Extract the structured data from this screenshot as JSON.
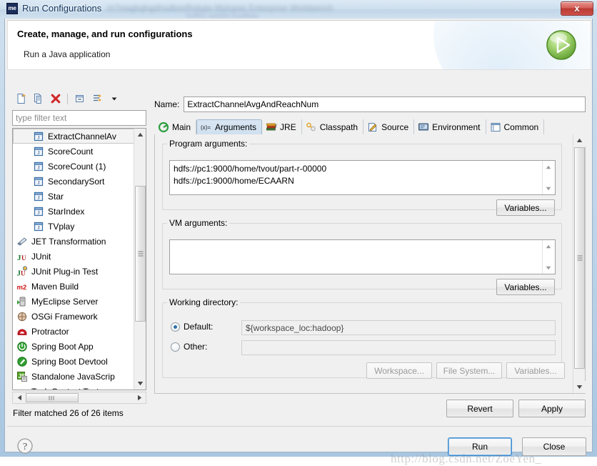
{
  "window": {
    "title": "Run Configurations",
    "app_icon_text": "me",
    "close_label": "x",
    "ghost_text_1": "  m7ewgbqhgdhsdbxefhstyjw   Mylcpse Enterprise Workbench",
    "ghost_text_2": "    Sdfhx wkfghj ksdfjwe"
  },
  "banner": {
    "title": "Create, manage, and run configurations",
    "subtitle": "Run a Java application",
    "run_icon": "run-play-icon"
  },
  "tree_toolbar": {
    "buttons": [
      {
        "name": "new-configuration-icon",
        "tooltip": "New launch configuration"
      },
      {
        "name": "duplicate-configuration-icon",
        "tooltip": "Duplicate"
      },
      {
        "name": "delete-configuration-icon",
        "tooltip": "Delete"
      },
      {
        "name": "collapse-all-icon",
        "tooltip": "Collapse All"
      },
      {
        "name": "filter-configuration-icon",
        "tooltip": "Filter"
      },
      {
        "name": "view-menu-chevron-icon",
        "tooltip": "View Menu"
      }
    ]
  },
  "filter": {
    "placeholder": "type filter text",
    "value": "",
    "status": "Filter matched 26 of 26 items"
  },
  "tree": {
    "items": [
      {
        "label": "ExtractChannelAv",
        "icon": "java-launch-icon",
        "indent": "child",
        "selected": true
      },
      {
        "label": "ScoreCount",
        "icon": "java-launch-icon",
        "indent": "child",
        "selected": false
      },
      {
        "label": "ScoreCount (1)",
        "icon": "java-launch-icon",
        "indent": "child",
        "selected": false
      },
      {
        "label": "SecondarySort",
        "icon": "java-launch-icon",
        "indent": "child",
        "selected": false
      },
      {
        "label": "Star",
        "icon": "java-launch-icon",
        "indent": "child",
        "selected": false
      },
      {
        "label": "StarIndex",
        "icon": "java-launch-icon",
        "indent": "child",
        "selected": false
      },
      {
        "label": "TVplay",
        "icon": "java-launch-icon",
        "indent": "child",
        "selected": false
      },
      {
        "label": "JET Transformation",
        "icon": "jet-transformation-icon",
        "indent": "root",
        "selected": false
      },
      {
        "label": "JUnit",
        "icon": "junit-icon",
        "indent": "root",
        "selected": false
      },
      {
        "label": "JUnit Plug-in Test",
        "icon": "junit-plugin-icon",
        "indent": "root",
        "selected": false
      },
      {
        "label": "Maven Build",
        "icon": "maven-icon",
        "indent": "root",
        "selected": false
      },
      {
        "label": "MyEclipse Server",
        "icon": "myeclipse-server-icon",
        "indent": "root",
        "selected": false
      },
      {
        "label": "OSGi Framework",
        "icon": "osgi-icon",
        "indent": "root",
        "selected": false
      },
      {
        "label": "Protractor",
        "icon": "protractor-icon",
        "indent": "root",
        "selected": false
      },
      {
        "label": "Spring Boot App",
        "icon": "spring-boot-icon",
        "indent": "root",
        "selected": false
      },
      {
        "label": "Spring Boot Devtool",
        "icon": "spring-devtools-icon",
        "indent": "root",
        "selected": false
      },
      {
        "label": "Standalone JavaScrip",
        "icon": "javascript-icon",
        "indent": "root",
        "selected": false
      },
      {
        "label": "Task Context Test",
        "icon": "task-context-icon",
        "indent": "root",
        "selected": false
      }
    ]
  },
  "config": {
    "name_label": "Name:",
    "name_value": "ExtractChannelAvgAndReachNum"
  },
  "tabs": [
    {
      "label": "Main",
      "icon": "main-tab-icon",
      "active": false
    },
    {
      "label": "Arguments",
      "icon": "arguments-tab-icon",
      "active": true
    },
    {
      "label": "JRE",
      "icon": "jre-tab-icon",
      "active": false
    },
    {
      "label": "Classpath",
      "icon": "classpath-tab-icon",
      "active": false
    },
    {
      "label": "Source",
      "icon": "source-tab-icon",
      "active": false
    },
    {
      "label": "Environment",
      "icon": "environment-tab-icon",
      "active": false
    },
    {
      "label": "Common",
      "icon": "common-tab-icon",
      "active": false
    }
  ],
  "arguments": {
    "program_args": {
      "legend": "Program arguments:",
      "value": "hdfs://pc1:9000/home/tvout/part-r-00000\nhdfs://pc1:9000/home/ECAARN",
      "variables_button": "Variables..."
    },
    "vm_args": {
      "legend": "VM arguments:",
      "value": "",
      "variables_button": "Variables..."
    },
    "working_directory": {
      "legend": "Working directory:",
      "default_label": "Default:",
      "default_value": "${workspace_loc:hadoop}",
      "default_selected": true,
      "other_label": "Other:",
      "other_value": "",
      "other_selected": false,
      "workspace_button": "Workspace...",
      "filesystem_button": "File System...",
      "variables_button": "Variables..."
    }
  },
  "footer": {
    "revert_button": "Revert",
    "apply_button": "Apply",
    "run_button": "Run",
    "close_button": "Close",
    "help_icon": "help-question-icon"
  },
  "watermark": "http://blog.csdn.net/ZoeYen_",
  "colors": {
    "accent_blue": "#3c8ad0",
    "title_text": "#16385e",
    "active_tab": "#cfe0f0",
    "close_red": "#bb3a33",
    "run_green": "#67b036"
  }
}
